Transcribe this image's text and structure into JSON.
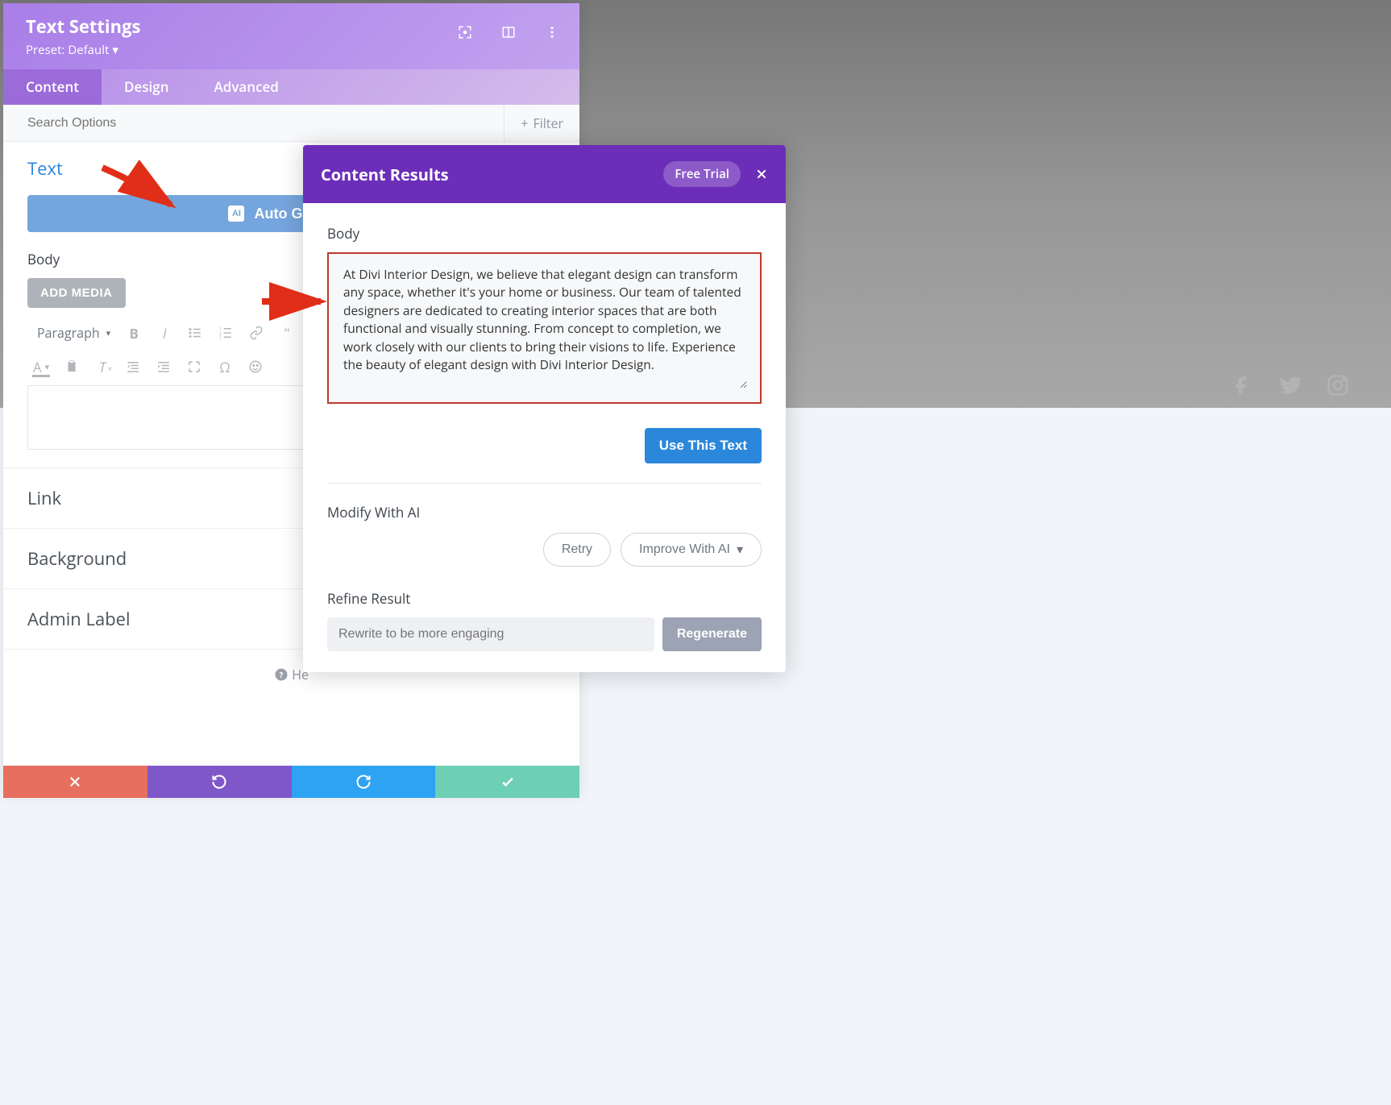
{
  "settings": {
    "title": "Text Settings",
    "preset_label": "Preset: Default",
    "tabs": {
      "content": "Content",
      "design": "Design",
      "advanced": "Advanced"
    },
    "search_placeholder": "Search Options",
    "filter_label": "Filter"
  },
  "text_section": {
    "title": "Text",
    "auto_generate_label": "Auto Generate",
    "body_label": "Body",
    "add_media_label": "ADD MEDIA",
    "paragraph_label": "Paragraph"
  },
  "collapsed_sections": {
    "link": "Link",
    "background": "Background",
    "admin_label": "Admin Label"
  },
  "help_label": "He",
  "modal": {
    "title": "Content Results",
    "free_trial": "Free Trial",
    "body_label": "Body",
    "result_text": "At Divi Interior Design, we believe that elegant design can transform any space, whether it's your home or business. Our team of talented designers are dedicated to creating interior spaces that are both functional and visually stunning. From concept to completion, we work closely with our clients to bring their visions to life. Experience the beauty of elegant design with Divi Interior Design.",
    "use_this_text": "Use This Text",
    "modify_label": "Modify With AI",
    "retry_label": "Retry",
    "improve_label": "Improve With AI",
    "refine_label": "Refine Result",
    "refine_placeholder": "Rewrite to be more engaging",
    "regenerate_label": "Regenerate"
  }
}
